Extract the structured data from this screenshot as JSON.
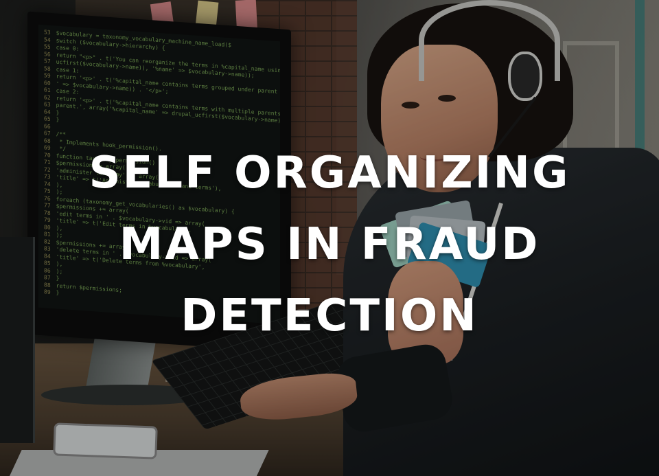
{
  "title": {
    "lines": [
      "SELF ORGANIZING",
      "MAPS IN FRAUD",
      "DETECTION"
    ]
  },
  "monitor_code": [
    {
      "ln": "53",
      "text": "$vocabulary = taxonomy_vocabulary_machine_name_load($"
    },
    {
      "ln": "54",
      "text": "switch ($vocabulary->hierarchy) {"
    },
    {
      "ln": "55",
      "text": "case 0:"
    },
    {
      "ln": "56",
      "text": "return \"<p>\" . t('You can reorganize the terms in %capital_name using their drag') . '</p>';"
    },
    {
      "ln": "57",
      "text": "ucfirst($vocabulary->name)), '%name' => $vocabulary->name));"
    },
    {
      "ln": "58",
      "text": "case 1:"
    },
    {
      "ln": "59",
      "text": "return '<p>' . t('%capital_name contains terms grouped under parent terms') . '</p>';"
    },
    {
      "ln": "60",
      "text": "' => $vocabulary->name)) . '</p>';"
    },
    {
      "ln": "61",
      "text": "case 2:"
    },
    {
      "ln": "62",
      "text": "return '<p>' . t('%capital_name contains terms with multiple parents') . '</p>';"
    },
    {
      "ln": "63",
      "text": "parent.', array('%capital_name' => drupal_ucfirst($vocabulary->name))) . '</p>';"
    },
    {
      "ln": "64",
      "text": "}"
    },
    {
      "ln": "65",
      "text": "}"
    },
    {
      "ln": "66",
      "text": ""
    },
    {
      "ln": "67",
      "text": "/**"
    },
    {
      "ln": "68",
      "text": " * Implements hook_permission()."
    },
    {
      "ln": "69",
      "text": " */"
    },
    {
      "ln": "70",
      "text": "function taxonomy_permission() {"
    },
    {
      "ln": "71",
      "text": "$permissions = array("
    },
    {
      "ln": "72",
      "text": "'administer taxonomy' => array("
    },
    {
      "ln": "73",
      "text": "'title' => t('Administer vocabularies and terms'),"
    },
    {
      "ln": "74",
      "text": "),"
    },
    {
      "ln": "75",
      "text": ");"
    },
    {
      "ln": "76",
      "text": "foreach (taxonomy_get_vocabularies() as $vocabulary) {"
    },
    {
      "ln": "77",
      "text": "$permissions += array("
    },
    {
      "ln": "78",
      "text": "'edit terms in ' . $vocabulary->vid => array("
    },
    {
      "ln": "79",
      "text": "'title' => t('Edit terms in %vocabulary',"
    },
    {
      "ln": "80",
      "text": "),"
    },
    {
      "ln": "81",
      "text": ");"
    },
    {
      "ln": "82",
      "text": "$permissions += array("
    },
    {
      "ln": "83",
      "text": "'delete terms in ' . $vocabulary->vid => array("
    },
    {
      "ln": "84",
      "text": "'title' => t('Delete terms from %vocabulary',"
    },
    {
      "ln": "85",
      "text": "),"
    },
    {
      "ln": "86",
      "text": ");"
    },
    {
      "ln": "87",
      "text": "}"
    },
    {
      "ln": "88",
      "text": "return $permissions;"
    },
    {
      "ln": "89",
      "text": "}"
    }
  ]
}
